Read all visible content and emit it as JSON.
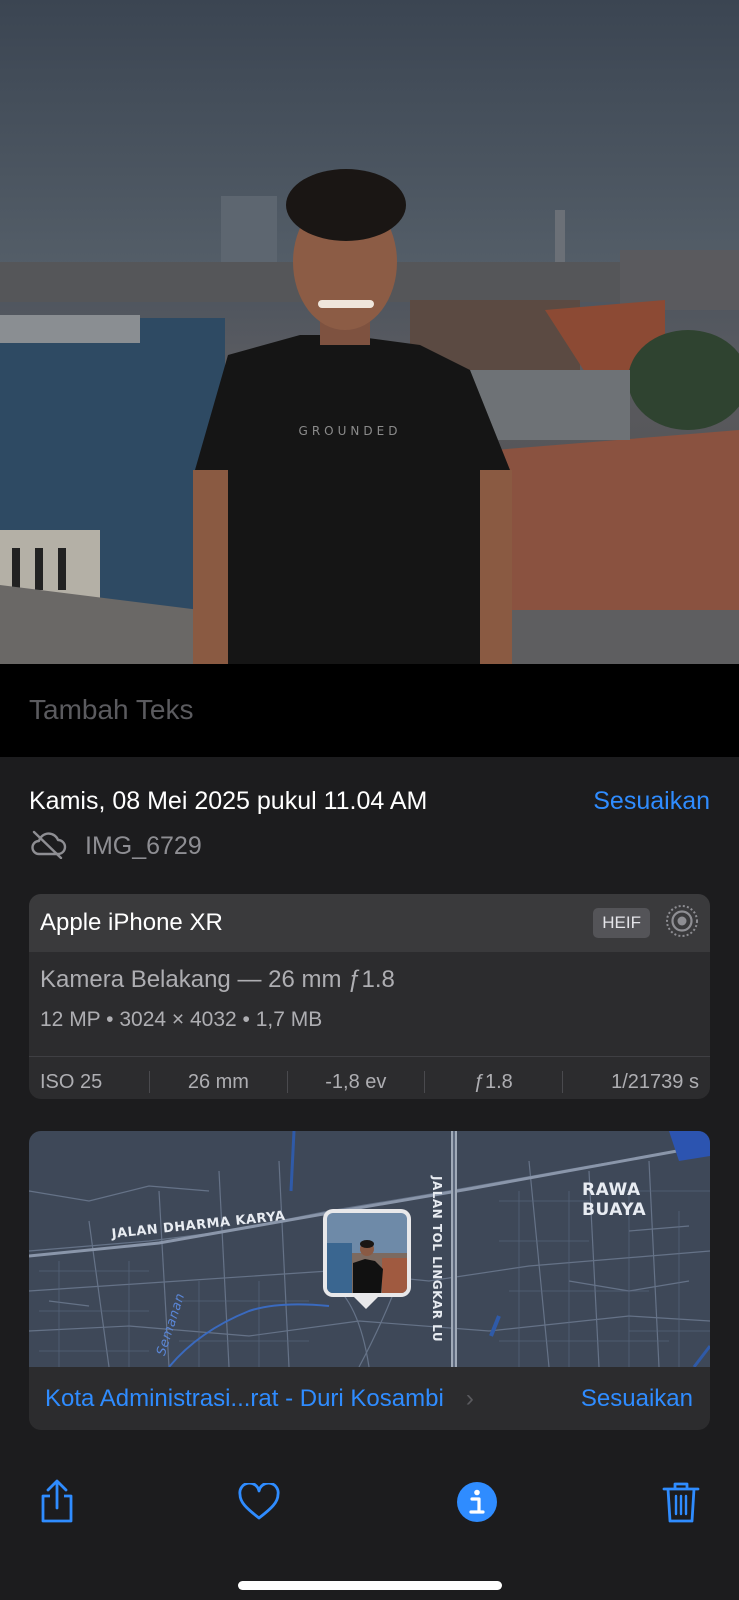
{
  "photo": {
    "shirt_text": "GROUNDED"
  },
  "caption": {
    "placeholder": "Tambah Teks"
  },
  "info": {
    "date": "Kamis, 08 Mei 2025 pukul 11.04 AM",
    "adjust_label": "Sesuaikan",
    "filename": "IMG_6729",
    "icons": {
      "cloud": "cloud-off-icon"
    }
  },
  "camera": {
    "device": "Apple iPhone XR",
    "format_badge": "HEIF",
    "lens": "Kamera Belakang — 26 mm ƒ1.8",
    "specs": "12 MP  •  3024 × 4032  •  1,7 MB",
    "exif": [
      "ISO 25",
      "26 mm",
      "-1,8 ev",
      "ƒ1.8",
      "1/21739 s"
    ],
    "icons": {
      "live": "live-photo-icon"
    }
  },
  "map": {
    "labels": {
      "road1": "JALAN DHARMA KARYA",
      "road2": "JALAN TOL LINGKAR LU",
      "area": "RAWA BUAYA",
      "river": "Semanan"
    },
    "location": "Kota Administrasi...rat - Duri Kosambi",
    "chevron": "›",
    "adjust_label": "Sesuaikan"
  },
  "toolbar": {
    "items": [
      "share-icon",
      "heart-icon",
      "info-icon",
      "trash-icon"
    ],
    "accent": "#2f8cff"
  },
  "colors": {
    "accent": "#2f8cff",
    "panel": "#1c1c1e",
    "card": "#2c2c2e"
  }
}
